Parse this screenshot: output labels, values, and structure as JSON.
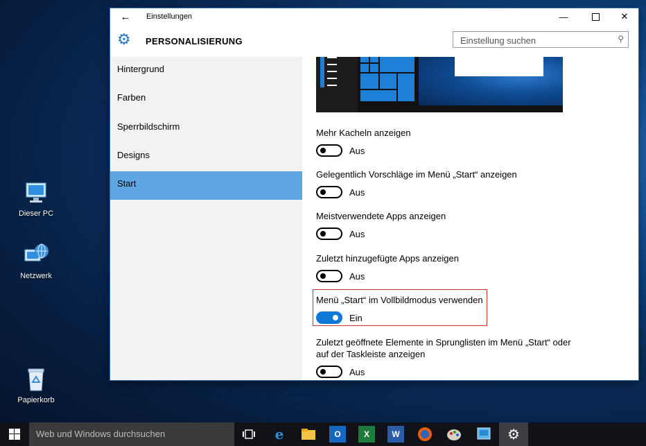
{
  "desktop": {
    "icons": [
      {
        "label": "Dieser PC",
        "icon": "computer-icon"
      },
      {
        "label": "Netzwerk",
        "icon": "network-icon"
      },
      {
        "label": "Papierkorb",
        "icon": "recycle-bin-icon"
      }
    ]
  },
  "window": {
    "title": "Einstellungen",
    "section_title": "PERSONALISIERUNG",
    "search_placeholder": "Einstellung suchen",
    "controls": [
      "minimize",
      "maximize",
      "close"
    ]
  },
  "sidebar": {
    "items": [
      {
        "label": "Hintergrund",
        "active": false
      },
      {
        "label": "Farben",
        "active": false
      },
      {
        "label": "Sperrbildschirm",
        "active": false
      },
      {
        "label": "Designs",
        "active": false
      },
      {
        "label": "Start",
        "active": true
      }
    ],
    "active_color": "#5ea7e3"
  },
  "settings": [
    {
      "label": "Mehr Kacheln anzeigen",
      "state": "Aus",
      "on": false
    },
    {
      "label": "Gelegentlich Vorschläge im Menü „Start“ anzeigen",
      "state": "Aus",
      "on": false
    },
    {
      "label": "Meistverwendete Apps anzeigen",
      "state": "Aus",
      "on": false
    },
    {
      "label": "Zuletzt hinzugefügte Apps anzeigen",
      "state": "Aus",
      "on": false
    },
    {
      "label": "Menü „Start“ im Vollbildmodus verwenden",
      "state": "Ein",
      "on": true,
      "highlighted": true
    },
    {
      "label": "Zuletzt geöffnete Elemente in Sprunglisten im Menü „Start“ oder",
      "label2": "auf der Taskleiste anzeigen",
      "state": "Aus",
      "on": false
    }
  ],
  "taskbar": {
    "search_placeholder": "Web und Windows durchsuchen",
    "apps": [
      "task-view",
      "edge",
      "file-explorer",
      "outlook",
      "excel",
      "word",
      "firefox",
      "paint",
      "control-panel",
      "settings"
    ]
  },
  "colors": {
    "accent": "#0f79d7",
    "highlight_border": "#c0392b"
  }
}
